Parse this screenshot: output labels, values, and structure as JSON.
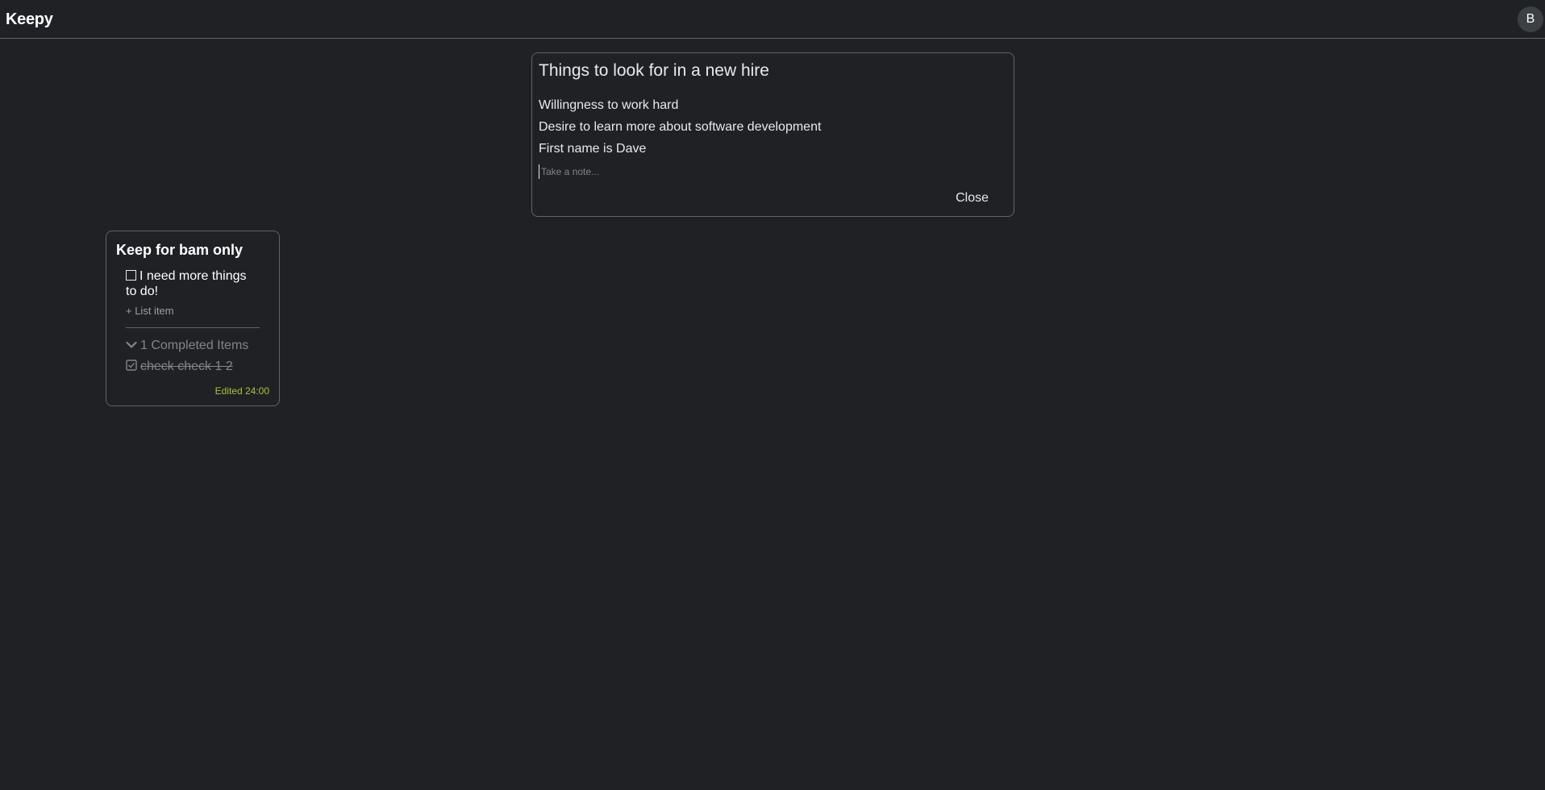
{
  "app": {
    "title": "Keepy",
    "avatar_initial": "B"
  },
  "editor": {
    "title": "Things to look for in a new hire",
    "lines": [
      "Willingness to work hard",
      "Desire to learn more about software development",
      "First name is Dave"
    ],
    "note_placeholder": "Take a note...",
    "close_label": "Close"
  },
  "card": {
    "title": "Keep for bam only",
    "items": [
      {
        "text": "I need more things to do!",
        "checked": false
      }
    ],
    "add_item_label": "+ List item",
    "completed_label": "1 Completed Items",
    "completed_items": [
      {
        "text": "check check 1 2",
        "checked": true
      }
    ],
    "edited_label": "Edited 24:00"
  },
  "colors": {
    "background": "#202124",
    "border": "#5f6368",
    "edited": "#a8c23c"
  },
  "icons": {
    "unchecked": "checkbox-icon",
    "checked": "checkbox-checked-icon",
    "expand": "chevron-down-icon"
  }
}
